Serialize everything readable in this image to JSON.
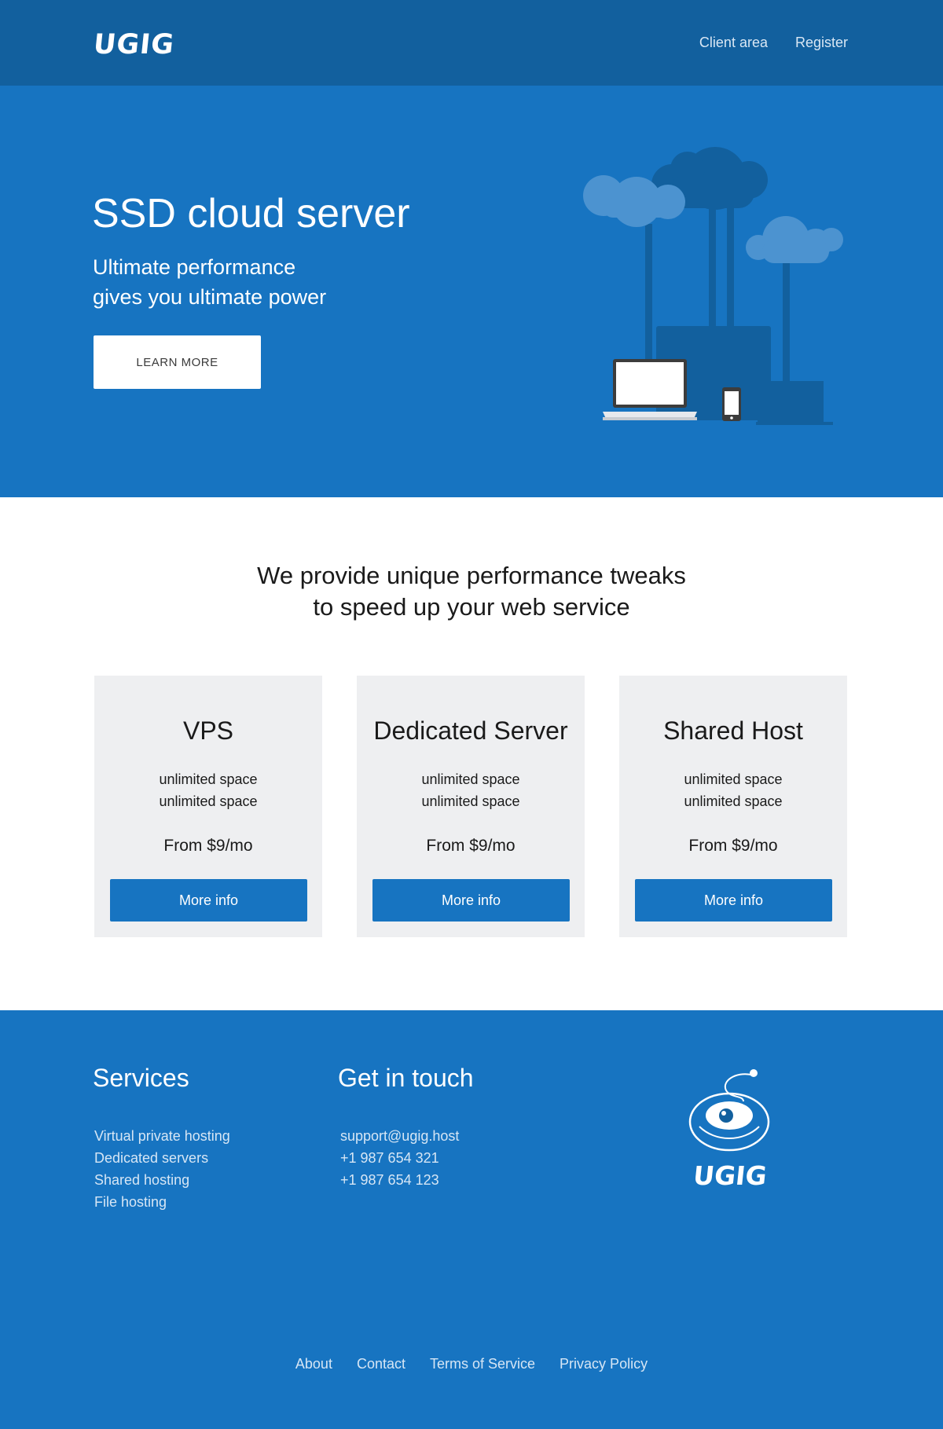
{
  "header": {
    "logo_text": "UGIG",
    "nav": [
      {
        "label": "Client area"
      },
      {
        "label": "Register"
      }
    ]
  },
  "hero": {
    "title": "SSD cloud server",
    "subtitle_line1": "Ultimate performance",
    "subtitle_line2": "gives you ultimate power",
    "button_label": "LEARN MORE",
    "illustration_icon": "cloud-server-icon"
  },
  "intro": {
    "line1": "We provide unique performance tweaks",
    "line2": "to speed up your web service"
  },
  "plans": [
    {
      "title": "VPS",
      "features": [
        "unlimited space",
        "unlimited space"
      ],
      "price": "From $9/mo",
      "button_label": "More info"
    },
    {
      "title": "Dedicated Server",
      "features": [
        "unlimited space",
        "unlimited space"
      ],
      "price": "From $9/mo",
      "button_label": "More info"
    },
    {
      "title": "Shared Host",
      "features": [
        "unlimited space",
        "unlimited space"
      ],
      "price": "From $9/mo",
      "button_label": "More info"
    }
  ],
  "footer": {
    "services_heading": "Services",
    "services": [
      "Virtual private hosting",
      "Dedicated servers",
      "Shared hosting",
      "File hosting"
    ],
    "contact_heading": "Get in touch",
    "contact": [
      "support@ugig.host",
      "+1 987  654  321",
      "+1 987  654  123"
    ],
    "logo_text": "UGIG",
    "logo_icon": "eye-mascot-icon",
    "links": [
      "About",
      "Contact",
      "Terms of Service",
      "Privacy Policy"
    ]
  },
  "colors": {
    "header_bg": "#12609e",
    "primary": "#1774c1",
    "card_bg": "#eeeff1",
    "illustration_dark": "#12609e",
    "illustration_light": "#4c93d0"
  }
}
